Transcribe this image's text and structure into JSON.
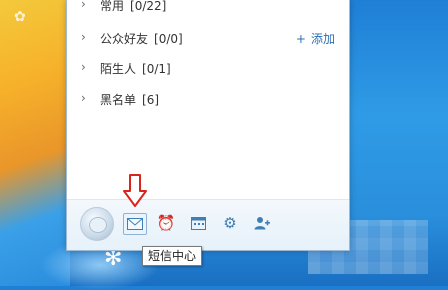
{
  "contact_groups": [
    {
      "name": "常用",
      "count": "[0/22]"
    },
    {
      "name": "公众好友",
      "count": "[0/0]"
    },
    {
      "name": "陌生人",
      "count": "[0/1]"
    },
    {
      "name": "黑名单",
      "count": "[6]"
    }
  ],
  "add_action": {
    "icon": "+",
    "label": "添加"
  },
  "tooltip": {
    "text": "短信中心"
  },
  "toolbar": {
    "buttons": [
      {
        "name": "sms-center",
        "icon": "mail-icon",
        "active": true
      },
      {
        "name": "alarm",
        "icon": "alarm-clock-icon"
      },
      {
        "name": "calendar",
        "icon": "calendar-icon"
      },
      {
        "name": "settings",
        "icon": "gear-icon"
      },
      {
        "name": "add-contact",
        "icon": "add-user-icon"
      }
    ]
  },
  "colors": {
    "accent": "#2b6fb8",
    "annotation": "#d9251c",
    "desktop": "#2f9be6"
  }
}
